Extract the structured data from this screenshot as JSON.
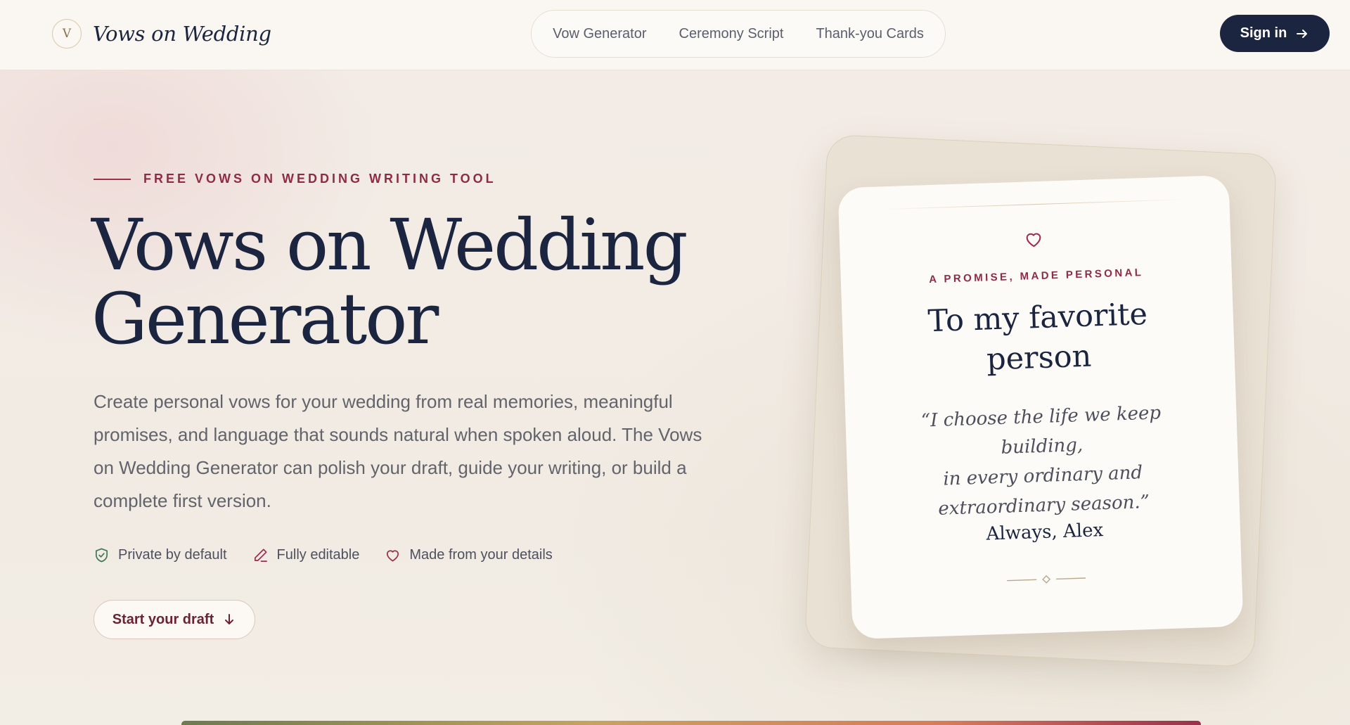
{
  "header": {
    "logo_letter": "V",
    "brand_name": "Vows on Wedding",
    "nav": [
      {
        "label": "Vow Generator"
      },
      {
        "label": "Ceremony Script"
      },
      {
        "label": "Thank-you Cards"
      }
    ],
    "signin_label": "Sign in"
  },
  "hero": {
    "eyebrow": "FREE VOWS ON WEDDING WRITING TOOL",
    "title_line1": "Vows on Wedding",
    "title_line2": "Generator",
    "description": "Create personal vows for your wedding from real memories, meaningful promises, and language that sounds natural when spoken aloud. The Vows on Wedding Generator can polish your draft, guide your writing, or build a complete first version.",
    "features": [
      {
        "icon": "shield-check-icon",
        "label": "Private by default"
      },
      {
        "icon": "pencil-icon",
        "label": "Fully editable"
      },
      {
        "icon": "heart-icon",
        "label": "Made from your details"
      }
    ],
    "cta_label": "Start your draft"
  },
  "card": {
    "kicker": "A PROMISE, MADE PERSONAL",
    "title_line1": "To my favorite",
    "title_line2": "person",
    "quote_line1": "“I choose the life we keep building,",
    "quote_line2": "in every ordinary and",
    "quote_line3": "extraordinary season.”",
    "signature": "Always, Alex"
  },
  "colors": {
    "navy": "#1b2540",
    "accent": "#9c2f4b",
    "background": "#f1ece4",
    "card": "#fdfbf7"
  }
}
